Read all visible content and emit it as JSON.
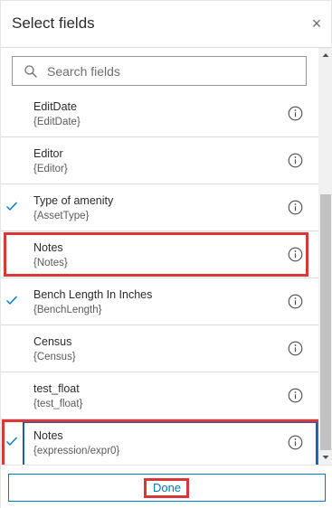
{
  "header": {
    "title": "Select fields",
    "close_glyph": "×"
  },
  "search": {
    "placeholder": "Search fields",
    "value": ""
  },
  "fields": [
    {
      "name": "EditDate",
      "field": "{EditDate}",
      "selected": false
    },
    {
      "name": "Editor",
      "field": "{Editor}",
      "selected": false
    },
    {
      "name": "Type of amenity",
      "field": "{AssetType}",
      "selected": true
    },
    {
      "name": "Notes",
      "field": "{Notes}",
      "selected": false,
      "highlighted": true
    },
    {
      "name": "Bench Length In Inches",
      "field": "{BenchLength}",
      "selected": true
    },
    {
      "name": "Census",
      "field": "{Census}",
      "selected": false
    },
    {
      "name": "test_float",
      "field": "{test_float}",
      "selected": false
    },
    {
      "name": "Notes",
      "field": "{expression/expr0}",
      "selected": true,
      "highlighted": true,
      "focused": true
    }
  ],
  "footer": {
    "done_label": "Done"
  },
  "colors": {
    "accent": "#007ac2",
    "highlight": "#d9383a",
    "focus": "#1b5fa8",
    "check": "#007ac2"
  },
  "icons": {
    "search": "search-icon",
    "info": "info-icon",
    "check": "check-icon",
    "close": "close-icon"
  }
}
